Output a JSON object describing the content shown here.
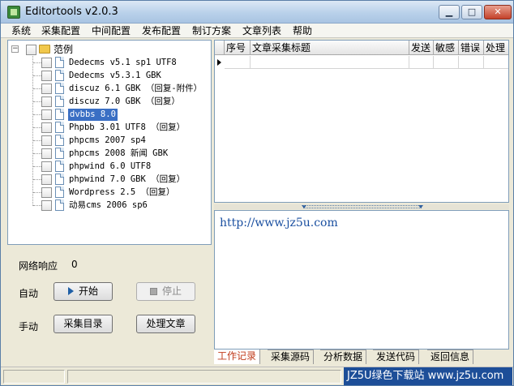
{
  "window": {
    "title": "Editortools v2.0.3"
  },
  "title_buttons": {
    "minimize": "▁",
    "maximize": "□",
    "close": "✕"
  },
  "menu": [
    "系统",
    "采集配置",
    "中间配置",
    "发布配置",
    "制订方案",
    "文章列表",
    "帮助"
  ],
  "tree": {
    "root_label": "范例",
    "items": [
      "Dedecms v5.1 sp1 UTF8",
      "Dedecms v5.3.1 GBK",
      "discuz 6.1 GBK （回复-附件）",
      "discuz 7.0 GBK （回复）",
      "dvbbs 8.0",
      "Phpbb 3.01 UTF8 （回复）",
      "phpcms 2007 sp4",
      "phpcms 2008 新闻 GBK",
      "phpwind 6.0 UTF8",
      "phpwind 7.0 GBK （回复）",
      "Wordpress 2.5 （回复）",
      "动易cms 2006 sp6"
    ],
    "selected_index": 4
  },
  "controls": {
    "network_label": "网络响应",
    "network_value": "0",
    "auto_label": "自动",
    "manual_label": "手动",
    "start_button": "开始",
    "stop_button": "停止",
    "collect_dir_button": "采集目录",
    "process_article_button": "处理文章"
  },
  "grid": {
    "columns": [
      "序号",
      "文章采集标题",
      "发送",
      "敏感",
      "错误",
      "处理"
    ]
  },
  "log": {
    "text": "http://www.jz5u.com"
  },
  "tabs": [
    "工作记录",
    "采集源码",
    "分析数据",
    "发送代码",
    "返回信息"
  ],
  "active_tab": 0,
  "watermark": "JZ5U绿色下载站 www.jz5u.com",
  "colors": {
    "accent": "#3a6fc4",
    "active_tab_text": "#c03a1a",
    "log_text": "#1a4fa0"
  }
}
